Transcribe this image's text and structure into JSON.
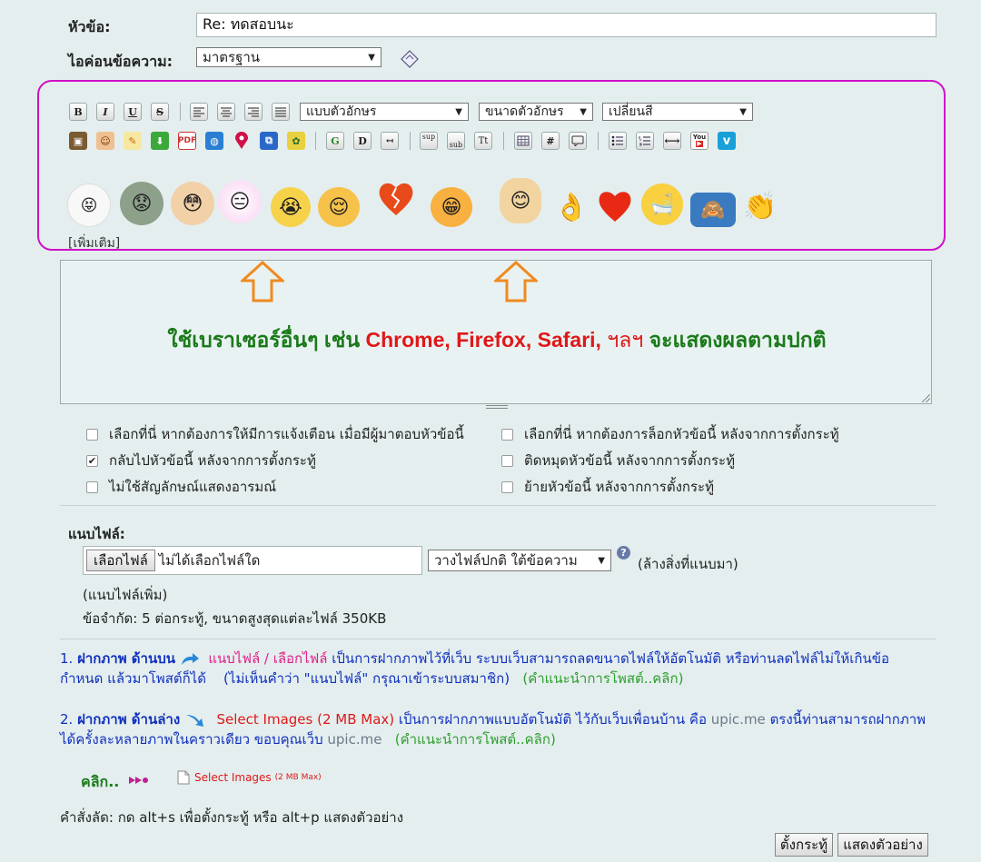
{
  "subject": {
    "label": "หัวข้อ:",
    "value": "Re: ทดสอบนะ"
  },
  "message_icon": {
    "label": "ไอค่อนข้อความ:",
    "selected": "มาตรฐาน"
  },
  "toolbar": {
    "bold": "B",
    "italic": "I",
    "underline": "U",
    "strike": "S",
    "font_face": "แบบตัวอักษร",
    "font_size": "ขนาดตัวอักษร",
    "font_color": "เปลี่ยนสี",
    "row2_icons": [
      "image-icon",
      "face-icon",
      "pencil-icon",
      "download-icon",
      "pdf-icon",
      "globe-icon",
      "map-pin-icon",
      "copy-icon",
      "flash-icon",
      "google-icon",
      "dictionary-icon",
      "return-icon",
      "superscript-icon",
      "subscript-icon",
      "teletype-icon",
      "table-icon",
      "hash-icon",
      "quote-icon",
      "bullet-list-icon",
      "numbered-list-icon",
      "horizontal-rule-icon",
      "youtube-icon",
      "vimeo-icon"
    ],
    "sup": "sup",
    "sub": "sub",
    "tt": "Tt",
    "hash": "#",
    "youtube": "You"
  },
  "smilies": {
    "more_label": "[เพิ่มเติม]"
  },
  "editor_notice": {
    "part1": "ใช้เบราเซอร์อื่นๆ เช่น ",
    "browsers": "Chrome, Firefox, Safari,",
    "part2": " ฯลฯ ",
    "part3": " จะแสดงผลตามปกติ"
  },
  "options": [
    {
      "label": "เลือกที่นี่ หากต้องการให้มีการแจ้งเตือน เมื่อมีผู้มาตอบหัวข้อนี้",
      "checked": false
    },
    {
      "label": "เลือกที่นี่ หากต้องการล็อกหัวข้อนี้ หลังจากการตั้งกระทู้",
      "checked": false
    },
    {
      "label": "กลับไปหัวข้อนี้ หลังจากการตั้งกระทู้",
      "checked": true
    },
    {
      "label": "ติดหมุดหัวข้อนี้ หลังจากการตั้งกระทู้",
      "checked": false
    },
    {
      "label": "ไม่ใช้สัญลักษณ์แสดงอารมณ์",
      "checked": false
    },
    {
      "label": "ย้ายหัวข้อนี้ หลังจากการตั้งกระทู้",
      "checked": false
    }
  ],
  "attach": {
    "label": "แนบไฟล์:",
    "choose_button": "เลือกไฟล์",
    "no_file": "ไม่ได้เลือกไฟล์ใด",
    "placement": "วางไฟล์ปกติ ใต้ข้อความ",
    "help": "?",
    "clear": "(ล้างสิ่งที่แนบมา)",
    "more": "(แนบไฟล์เพิ่ม)",
    "limits": "ข้อจำกัด: 5 ต่อกระทู้, ขนาดสูงสุดแต่ละไฟล์ 350KB"
  },
  "help1": {
    "num": "1. ",
    "title": "ฝากภาพ ด้านบน",
    "link": "แนบไฟล์ / เลือกไฟล์",
    "text1": " เป็นการฝากภาพไว้ที่เว็บ ระบบเว็บสามารถลดขนาดไฟล์ให้อัตโนมัติ หรือท่านลดไฟล์ไม่ให้เกินข้อกำหนด แล้วมาโพสต์ก็ได้",
    "note": "(ไม่เห็นคำว่า \"แนบไฟล์\" กรุณาเข้าระบบสมาชิก)",
    "tip": "(คำแนะนำการโพสต์..คลิก)"
  },
  "help2": {
    "num": "2. ",
    "title": "ฝากภาพ ด้านล่าง",
    "link": "Select Images (2 MB Max)",
    "text1": " เป็นการฝากภาพแบบอัตโนมัติ ไว้กับเว็บเพื่อนบ้าน คือ ",
    "site": "upic.me",
    "text2": " ตรงนี้ท่านสามารถฝากภาพได้ครั้งละหลายภาพในคราวเดียว ขอบคุณเว็บ ",
    "site2": "upic.me",
    "tip": "(คำแนะนำการโพสต์..คลิก)"
  },
  "click_here": "คลิก..",
  "select_images": {
    "label": "Select Images",
    "max": "(2 MB Max)"
  },
  "shortcuts": "คำสั่งลัด: กด alt+s เพื่อตั้งกระทู้ หรือ alt+p แสดงตัวอย่าง",
  "buttons": {
    "submit": "ตั้งกระทู้",
    "preview": "แสดงตัวอย่าง"
  },
  "colors": {
    "frame": "#d010c8",
    "notice_green": "#1a7a1a",
    "notice_red": "#e01818",
    "arrow_orange": "#f08a20"
  }
}
